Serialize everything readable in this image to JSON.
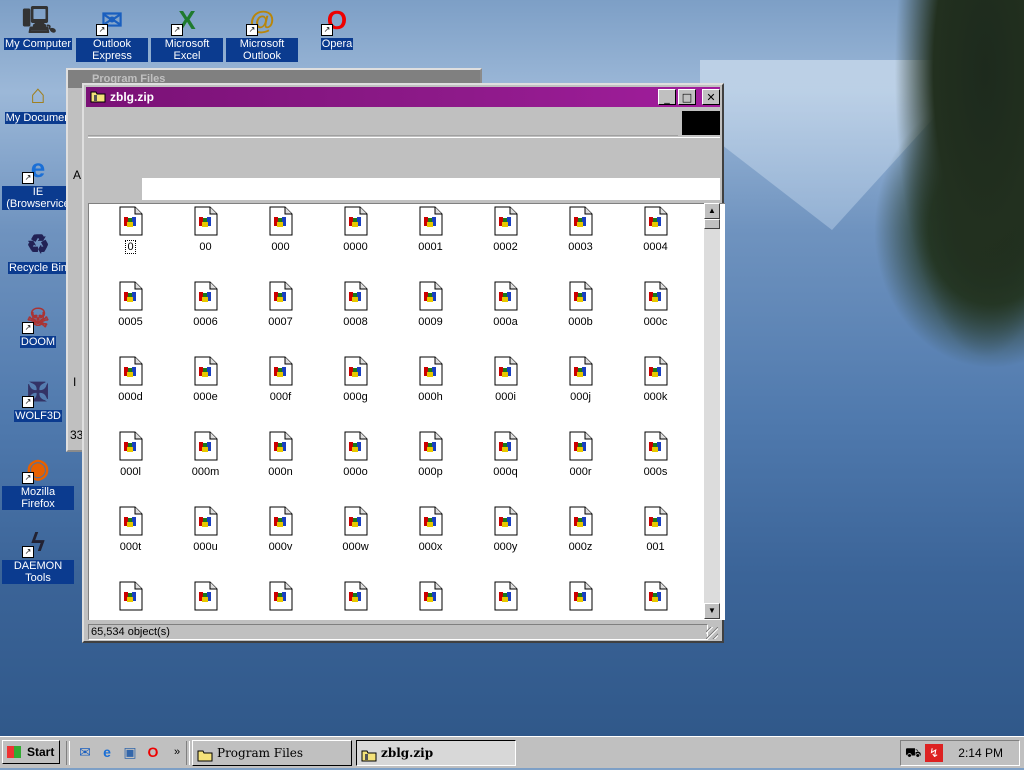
{
  "desktop": {
    "icons": [
      {
        "label": "My Computer",
        "icon": "my-computer-icon"
      },
      {
        "label": "Outlook Express",
        "icon": "outlook-express-icon"
      },
      {
        "label": "Microsoft Excel",
        "icon": "excel-icon"
      },
      {
        "label": "Microsoft Outlook",
        "icon": "outlook-icon"
      },
      {
        "label": "Opera",
        "icon": "opera-icon"
      },
      {
        "label": "My Documen",
        "icon": "my-documents-icon"
      },
      {
        "label": "IE (Browservice",
        "icon": "internet-explorer-icon"
      },
      {
        "label": "Recycle Bin",
        "icon": "recycle-bin-icon"
      },
      {
        "label": "DOOM",
        "icon": "doom-icon"
      },
      {
        "label": "WOLF3D",
        "icon": "wolf3d-icon"
      },
      {
        "label": "Mozilla Firefox",
        "icon": "firefox-icon"
      },
      {
        "label": "DAEMON Tools",
        "icon": "daemon-tools-icon"
      }
    ]
  },
  "back_window": {
    "title": "Program Files",
    "edge_chars": [
      "A",
      "I",
      "33"
    ]
  },
  "window": {
    "title": "zblg.zip",
    "buttons": {
      "minimize": "_",
      "maximize": "□",
      "close": "✕"
    },
    "status": "65,534 object(s)",
    "files": [
      "0",
      "00",
      "000",
      "0000",
      "0001",
      "0002",
      "0003",
      "0004",
      "0005",
      "0006",
      "0007",
      "0008",
      "0009",
      "000a",
      "000b",
      "000c",
      "000d",
      "000e",
      "000f",
      "000g",
      "000h",
      "000i",
      "000j",
      "000k",
      "000l",
      "000m",
      "000n",
      "000o",
      "000p",
      "000q",
      "000r",
      "000s",
      "000t",
      "000u",
      "000v",
      "000w",
      "000x",
      "000y",
      "000z",
      "001",
      "",
      "",
      "",
      "",
      "",
      "",
      "",
      ""
    ],
    "selected_file": "0"
  },
  "taskbar": {
    "start_label": "Start",
    "quick_launch": [
      "outlook-express-icon",
      "internet-explorer-icon",
      "desktop-icon",
      "opera-icon"
    ],
    "overflow": "»",
    "tasks": [
      {
        "label": "Program Files",
        "active": false
      },
      {
        "label": "zblg.zip",
        "active": true
      }
    ],
    "clock": "2:14 PM"
  },
  "colors": {
    "title_active": "#7a1176",
    "title_inactive": "#808080",
    "face": "#c0c0c0"
  }
}
